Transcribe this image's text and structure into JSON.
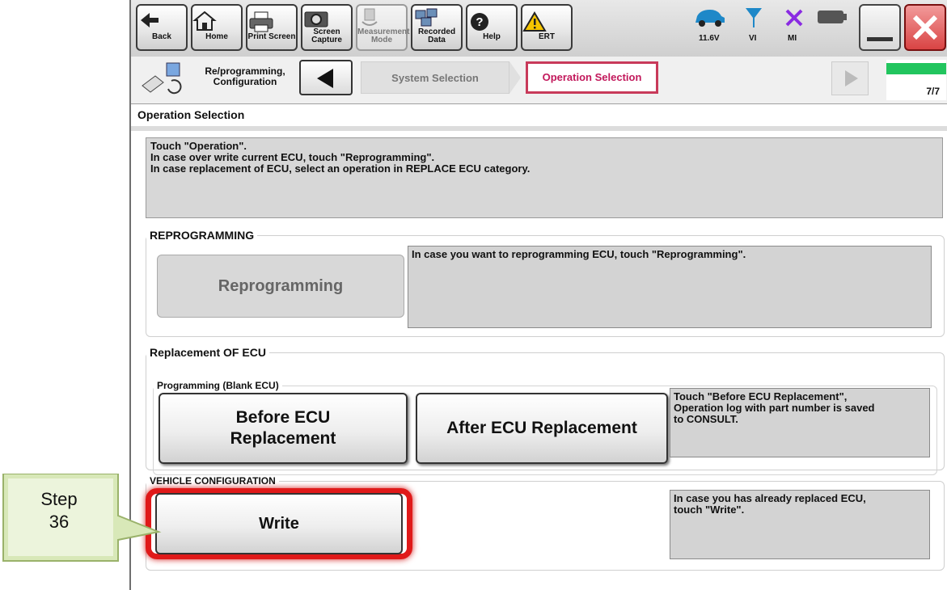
{
  "toolbar": {
    "buttons": [
      {
        "label": "Back",
        "icon": "back-arrow-icon"
      },
      {
        "label": "Home",
        "icon": "home-icon"
      },
      {
        "label": "Print Screen",
        "icon": "printer-icon"
      },
      {
        "label": "Screen\nCapture",
        "icon": "camera-icon"
      },
      {
        "label": "Measurement\nMode",
        "icon": "measurement-icon"
      },
      {
        "label": "Recorded\nData",
        "icon": "recorded-data-icon"
      },
      {
        "label": "Help",
        "icon": "help-icon"
      },
      {
        "label": "ERT",
        "icon": "warning-icon"
      }
    ],
    "status": {
      "voltage": "11.6V",
      "vi": "VI",
      "mi": "MI"
    }
  },
  "nav": {
    "title": "Re/programming,\nConfiguration",
    "crumb_system": "System Selection",
    "crumb_operation": "Operation Selection",
    "progress": "7/7",
    "progress_fraction": 1.0
  },
  "page": {
    "title": "Operation Selection",
    "instruction": "Touch \"Operation\".\nIn case over write current ECU, touch \"Reprogramming\".\nIn case replacement of ECU, select an operation in REPLACE ECU category."
  },
  "reprogramming": {
    "legend": "REPROGRAMMING",
    "button": "Reprogramming",
    "description": "In case you want to reprogramming ECU, touch \"Reprogramming\"."
  },
  "replacement": {
    "legend": "Replacement OF ECU",
    "sub_legend": "Programming (Blank ECU)",
    "before_button": "Before ECU\nReplacement",
    "after_button": "After ECU Replacement",
    "description": "Touch \"Before ECU Replacement\",\nOperation log with part number is saved\nto CONSULT."
  },
  "vehicle": {
    "legend": "VEHICLE CONFIGURATION",
    "button": "Write",
    "description": "In case you has already replaced ECU,\ntouch \"Write\"."
  },
  "callout": {
    "label": "Step\n36"
  },
  "colors": {
    "highlight": "#e01919",
    "active_crumb": "#c83a5a",
    "progress": "#22c55e"
  }
}
